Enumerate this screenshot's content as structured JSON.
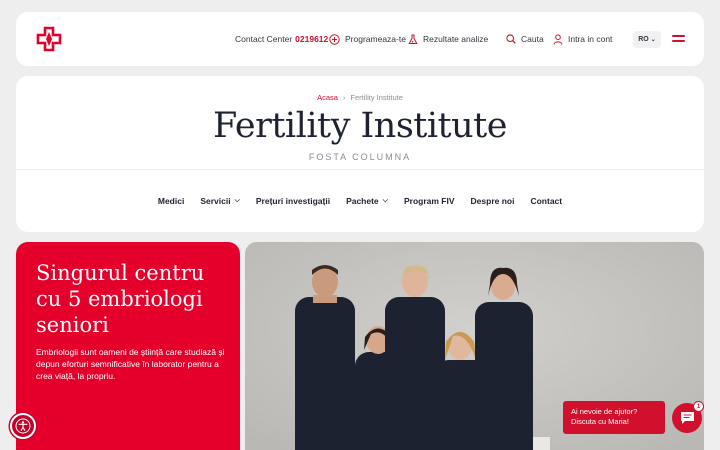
{
  "header": {
    "contact_label": "Contact Center",
    "contact_number": "0219612",
    "schedule_label": "Programeaza-te",
    "results_label": "Rezultate analize",
    "search_label": "Cauta",
    "login_label": "Intra in cont",
    "language": "RO"
  },
  "breadcrumb": {
    "home": "Acasa",
    "separator": "›",
    "current": "Fertility Institute"
  },
  "page": {
    "title": "Fertility Institute",
    "subtitle": "FOSTA COLUMNA"
  },
  "menu": [
    {
      "label": "Medici",
      "dropdown": false
    },
    {
      "label": "Servicii",
      "dropdown": true
    },
    {
      "label": "Prețuri investigații",
      "dropdown": false
    },
    {
      "label": "Pachete",
      "dropdown": true
    },
    {
      "label": "Program FIV",
      "dropdown": false
    },
    {
      "label": "Despre noi",
      "dropdown": false
    },
    {
      "label": "Contact",
      "dropdown": false
    }
  ],
  "promo": {
    "title": "Singurul centru cu 5 embriologi seniori",
    "text": "Embriologii sunt oameni de știință care studiază și depun eforturi semnificative în laborator pentru a crea viață, la propriu."
  },
  "chat": {
    "line1": "Ai nevoie de ajutor?",
    "line2": "Discuta cu Maria!",
    "badge": "1"
  },
  "colors": {
    "brand_red": "#e4002b",
    "accent_red": "#d0102c",
    "background": "#eeeeee",
    "card": "#ffffff"
  },
  "icons": [
    "logo-cross-icon",
    "calendar-plus-icon",
    "flask-icon",
    "search-icon",
    "user-icon",
    "chevron-down-icon",
    "hamburger-icon",
    "accessibility-icon",
    "chat-icon"
  ]
}
